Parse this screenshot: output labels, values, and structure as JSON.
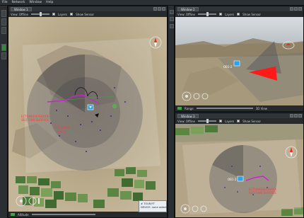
{
  "menubar": {
    "items": [
      "File",
      "Network",
      "Window",
      "Help"
    ]
  },
  "panes": {
    "main": {
      "tab": "Window 1",
      "toolbar": {
        "view_label": "View: Offline",
        "layers_label": "Layers",
        "show_sensor_label": "Show Sensor"
      },
      "status": {
        "alt_label": "Altitude"
      },
      "labels": {
        "track_a_line1": "ECTONIQUE/SHOCK",
        "track_a_line2": "SEQTONICSURFACE",
        "track_b_line1": "CPF MOVE",
        "track_b_line2": "Zone1"
      },
      "popup": {
        "line1": "# TOUR/FT",
        "line2": "DEVICE: none selected"
      }
    },
    "top_right": {
      "tab": "Window 2",
      "toolbar": {
        "view_label": "View: Offline",
        "layers_label": "Layers",
        "show_sensor_label": "Show Sensor"
      },
      "status": {
        "alt_label": "Range",
        "mode_label": "3D View"
      },
      "labels": {
        "marker": "OB1-2"
      }
    },
    "bottom_right": {
      "tab": "Window 3",
      "toolbar": {
        "view_label": "View: Offline",
        "layers_label": "Layers",
        "show_sensor_label": "Show Sensor"
      },
      "labels": {
        "marker": "OB1-2",
        "track_a_line1": "ECTONIQUE/SHOCK",
        "track_a_line2": "SEQTONICSURFACE"
      }
    }
  },
  "colors": {
    "terrain": "#b9a98a",
    "terrain_dark": "#8c7b62",
    "farm_green": "#4d7a3a",
    "sensor_red": "#ff1a1a",
    "track_magenta": "#d21bd6",
    "accent_green": "#3aa845"
  },
  "icons": [
    "compass-icon",
    "navigation-control-icon",
    "sensor-marker-icon"
  ]
}
